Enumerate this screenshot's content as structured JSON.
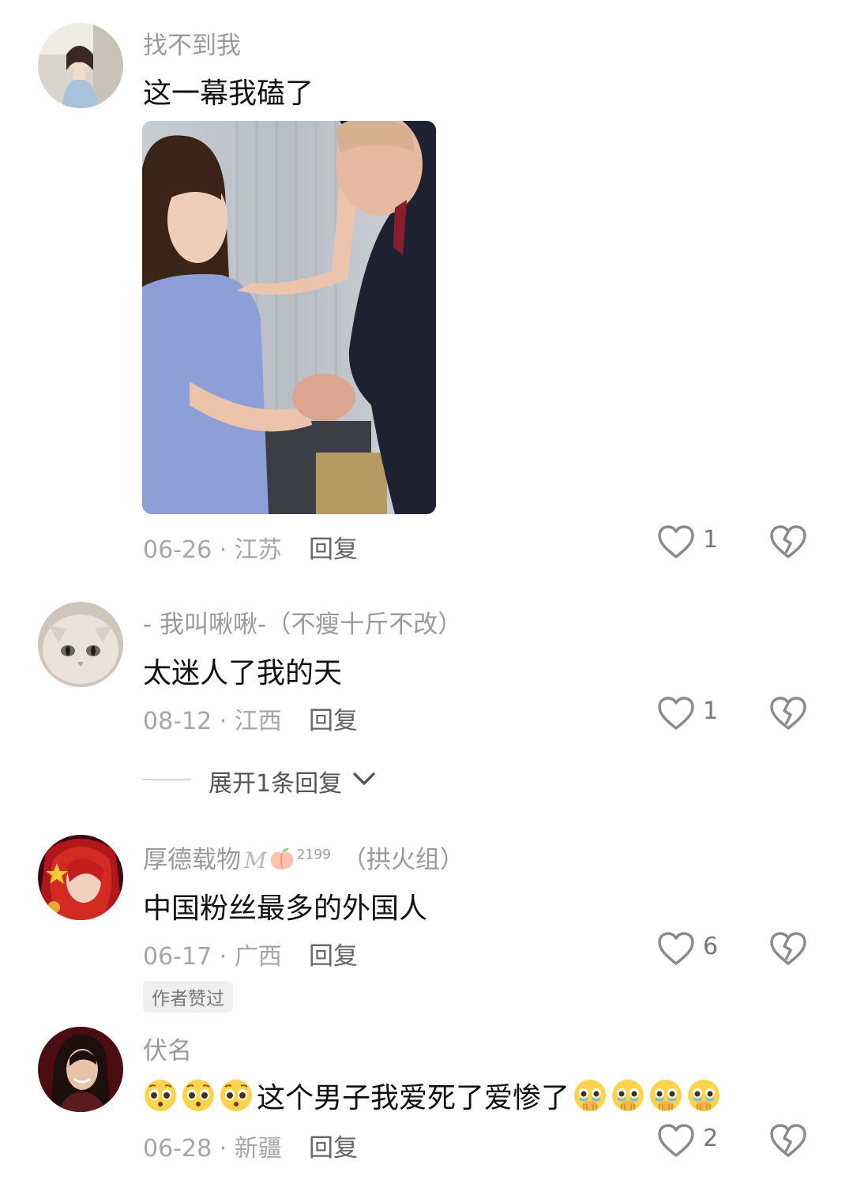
{
  "comments": [
    {
      "username": "找不到我",
      "text": "这一幕我磕了",
      "date": "06-26",
      "location": "江苏",
      "reply_label": "回复",
      "likes": "1"
    },
    {
      "username": "- 我叫啾啾-（不瘦十斤不改）",
      "text": "太迷人了我的天",
      "date": "08-12",
      "location": "江西",
      "reply_label": "回复",
      "likes": "1",
      "expand_label": "展开1条回复"
    },
    {
      "username": "厚德载物",
      "username_badge": "M",
      "username_level": "2199",
      "username_suffix": "（拱火组）",
      "text": "中国粉丝最多的外国人",
      "date": "06-17",
      "location": "广西",
      "reply_label": "回复",
      "likes": "6",
      "author_tag": "作者赞过"
    },
    {
      "username": "伏名",
      "text": "这个男子我爱死了爱惨了",
      "date": "06-28",
      "location": "新疆",
      "reply_label": "回复",
      "likes": "2"
    }
  ],
  "meta_separator": " · ",
  "icons": {
    "like": "heart-outline-icon",
    "dislike": "broken-heart-icon",
    "expand": "chevron-down-icon",
    "emoji_flushed": "pleading-face-icon",
    "emoji_crying": "holding-back-tears-icon"
  },
  "colors": {
    "meta_text": "#a6a6a6",
    "username": "#9a9a9a",
    "icon_stroke": "#8a8a8a"
  }
}
